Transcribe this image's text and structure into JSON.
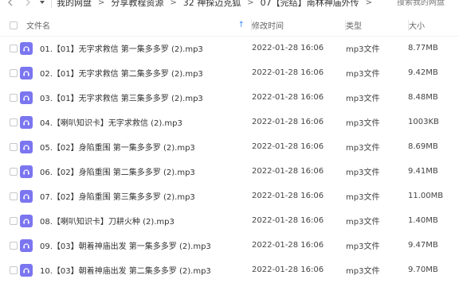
{
  "breadcrumb": {
    "items": [
      "我的网盘",
      "分享教程资源",
      "32 神探迈克狐",
      "07【完结】南林神庙外传"
    ],
    "separator": ">"
  },
  "search": {
    "placeholder": "搜索我的网盘"
  },
  "columns": {
    "name": "文件名",
    "date": "修改时间",
    "type": "类型",
    "size": "大小"
  },
  "files": [
    {
      "name": "01.【01】无字求救信 第一集多多罗 (2).mp3",
      "date": "2022-01-28 16:06",
      "type": "mp3文件",
      "size": "8.77MB"
    },
    {
      "name": "02.【01】无字求救信 第二集多多罗 (2).mp3",
      "date": "2022-01-28 16:06",
      "type": "mp3文件",
      "size": "9.42MB"
    },
    {
      "name": "03.【01】无字求救信 第三集多多罗 (2).mp3",
      "date": "2022-01-28 16:06",
      "type": "mp3文件",
      "size": "8.48MB"
    },
    {
      "name": "04.【喇叭知识卡】无字求救信 (2).mp3",
      "date": "2022-01-28 16:06",
      "type": "mp3文件",
      "size": "1003KB"
    },
    {
      "name": "05.【02】身陷重围 第一集多多罗 (2).mp3",
      "date": "2022-01-28 16:06",
      "type": "mp3文件",
      "size": "8.69MB"
    },
    {
      "name": "06.【02】身陷重围 第二集多多罗 (2).mp3",
      "date": "2022-01-28 16:06",
      "type": "mp3文件",
      "size": "9.41MB"
    },
    {
      "name": "07.【02】身陷重围 第三集多多罗 (2).mp3",
      "date": "2022-01-28 16:06",
      "type": "mp3文件",
      "size": "11.00MB"
    },
    {
      "name": "08.【喇叭知识卡】刀耕火种 (2).mp3",
      "date": "2022-01-28 16:06",
      "type": "mp3文件",
      "size": "1.40MB"
    },
    {
      "name": "09.【03】朝着神庙出发 第一集多多罗 (2).mp3",
      "date": "2022-01-28 16:06",
      "type": "mp3文件",
      "size": "9.47MB"
    },
    {
      "name": "10.【03】朝着神庙出发 第二集多多罗 (2).mp3",
      "date": "2022-01-28 16:06",
      "type": "mp3文件",
      "size": "9.70MB"
    }
  ],
  "icons": {
    "back": "arrow-left-icon",
    "forward": "arrow-right-icon",
    "history": "chevron-down-icon",
    "sort": "sort-up-icon",
    "file": "audio-file-icon"
  },
  "colors": {
    "accent": "#3b8cff",
    "audio_icon": "#7b76f0"
  }
}
